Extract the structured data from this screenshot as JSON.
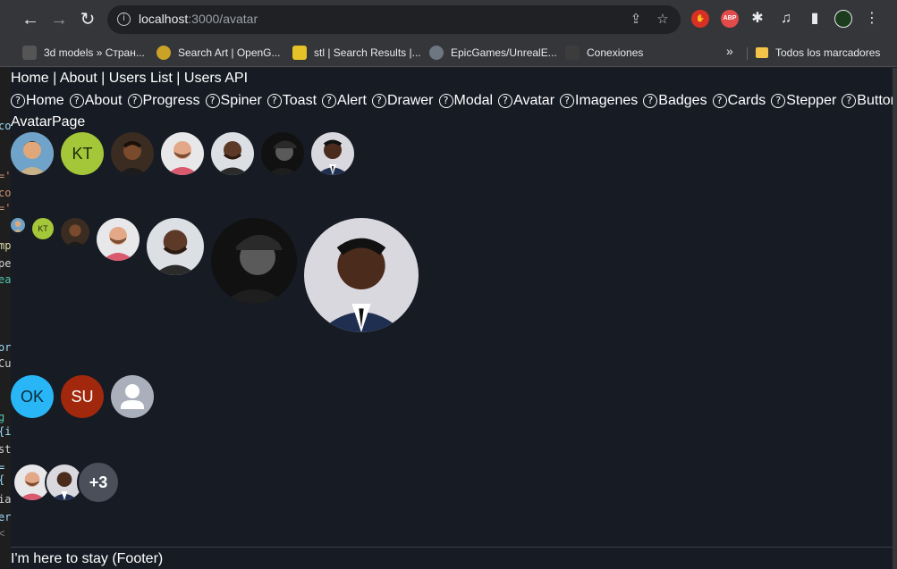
{
  "browser": {
    "url_host": "localhost",
    "url_path": ":3000/avatar",
    "bookmarks": [
      {
        "label": "3d models » Стран...",
        "color": "#555"
      },
      {
        "label": "Search Art | OpenG...",
        "color": "#c9a227"
      },
      {
        "label": "stl | Search Results |...",
        "color": "#e6c229"
      },
      {
        "label": "EpicGames/UnrealE...",
        "color": "#6e7681"
      },
      {
        "label": "Conexiones",
        "color": "#3c3c3c"
      }
    ],
    "bookmarks_more": "»",
    "all_bookmarks": "Todos los marcadores"
  },
  "nav": {
    "links": [
      "Home",
      "About",
      "Users List",
      "Users API"
    ],
    "separator": " | ",
    "components": [
      "Home",
      "About",
      "Progress",
      "Spiner",
      "Toast",
      "Alert",
      "Drawer",
      "Modal",
      "Avatar",
      "Imagenes",
      "Badges",
      "Cards",
      "Stepper",
      "Button"
    ]
  },
  "page": {
    "title": "AvatarPage",
    "initials_kt": "KT",
    "initials_ok": "OK",
    "initials_su": "SU",
    "group_more": "+3",
    "footer": "I'm here to stay (Footer)"
  },
  "colors": {
    "kt_bg": "#a4c639",
    "ok_bg": "#29b6f6",
    "su_bg": "#a1280d",
    "placeholder_bg": "#a9b0bc",
    "more_bg": "#4a4f5a"
  }
}
